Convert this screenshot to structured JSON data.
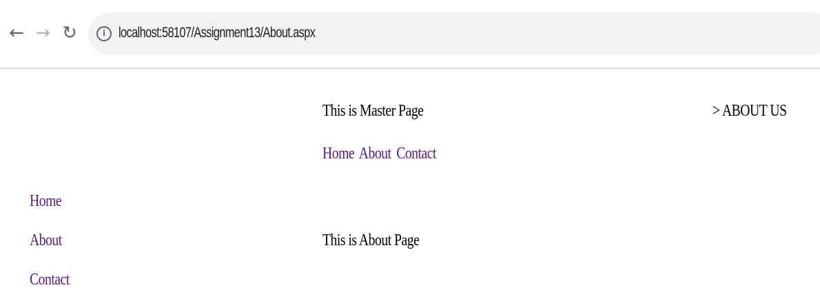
{
  "browser": {
    "back_icon": "arrow-left-icon",
    "forward_icon": "arrow-right-icon",
    "reload_icon": "reload-icon",
    "info_icon": "info-icon",
    "url": "localhost:58107/Assignment13/About.aspx"
  },
  "master": {
    "title": "This is Master Page",
    "breadcrumb": "> ABOUT US",
    "top_nav": [
      "Home",
      "About",
      "Contact"
    ],
    "side_nav": [
      "Home",
      "About",
      "Contact"
    ]
  },
  "content": {
    "text": "This is About Page"
  },
  "colors": {
    "link": "#551a8b",
    "text": "#000000",
    "omnibox": "#f1f3f4"
  }
}
